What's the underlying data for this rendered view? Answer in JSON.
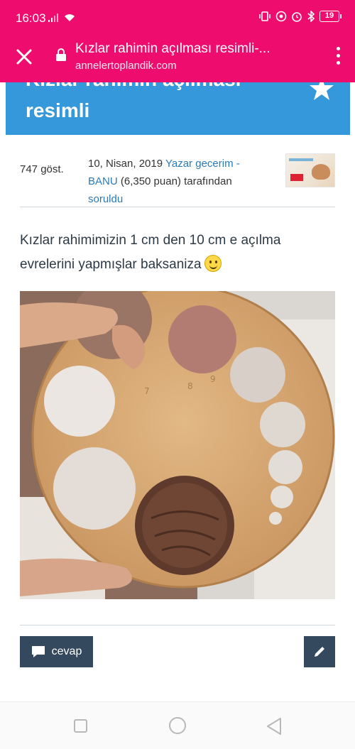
{
  "status_bar": {
    "time": "16:03",
    "battery": "19"
  },
  "address_bar": {
    "title": "Kızlar rahimin açılması resimli-...",
    "url": "annelertoplandik.com"
  },
  "question": {
    "title_line1": "Kızlar rahimin açılması",
    "title_line2": "resimli",
    "views": "747 göst.",
    "date": "10, Nisan, 2019",
    "category": "Yazar gecerim -",
    "author": "BANU",
    "points": "(6,350 puan)",
    "tafindan": "tarafından",
    "asked": "soruldu",
    "body": "Kızlar rahimimizin 1 cm den 10 cm e açılma evrelerini yapmışlar baksaniza"
  },
  "actions": {
    "reply_label": "cevap"
  },
  "colors": {
    "accent": "#ee0d6e",
    "header_blue": "#3498db",
    "button_dark": "#34495e",
    "link": "#2a7ab8"
  }
}
